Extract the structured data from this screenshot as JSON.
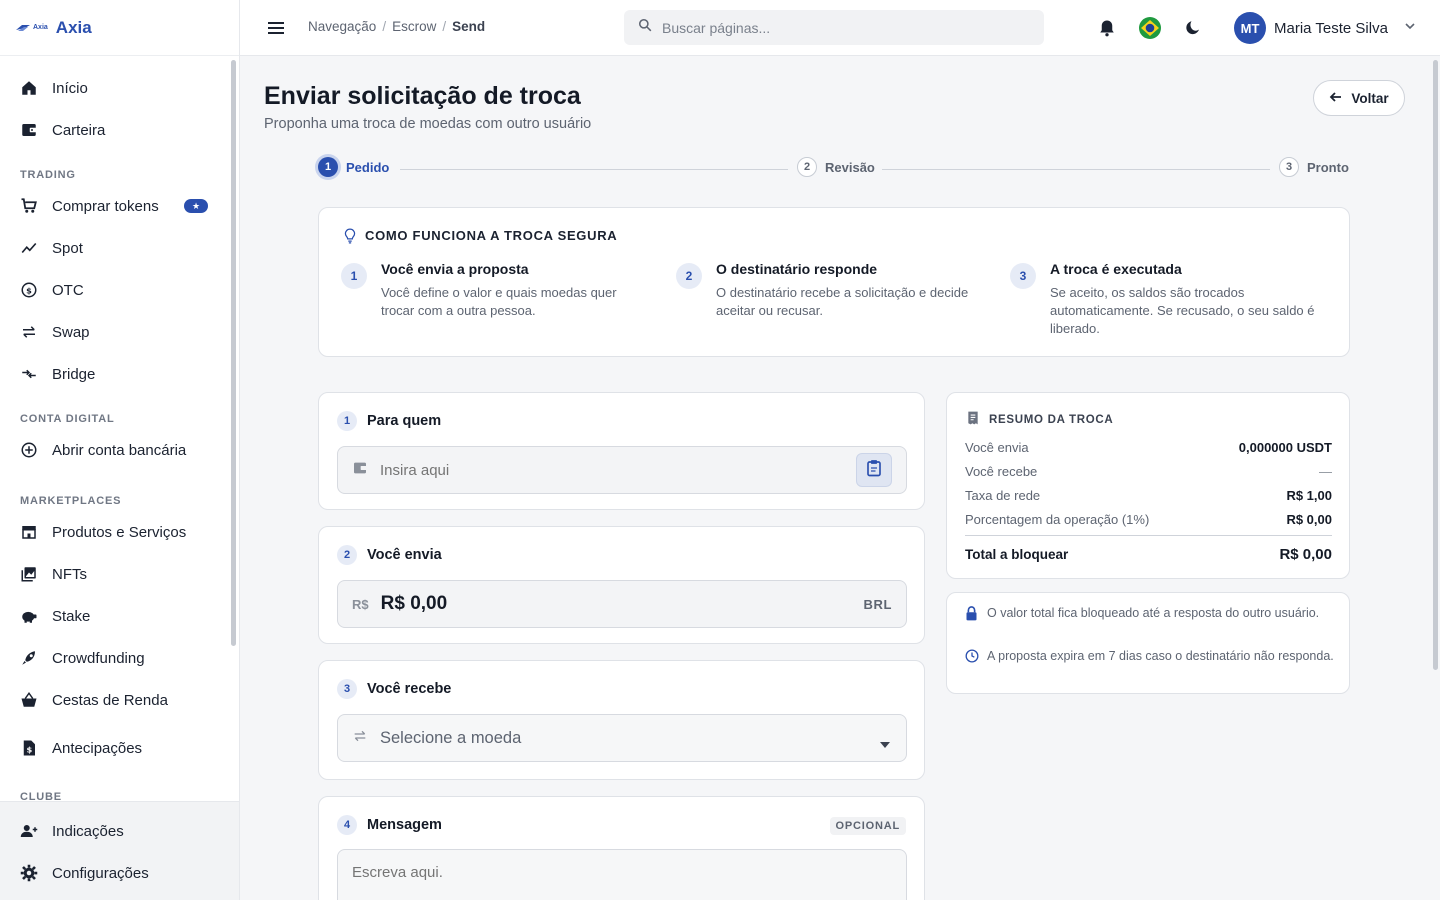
{
  "brand": {
    "mark_text": "Axia",
    "name": "Axia"
  },
  "sidebar": {
    "items_top": [
      {
        "label": "Início",
        "icon": "home-icon"
      },
      {
        "label": "Carteira",
        "icon": "wallet-icon"
      }
    ],
    "sections": [
      {
        "title": "TRADING",
        "items": [
          {
            "label": "Comprar tokens",
            "icon": "cart-icon",
            "badge": "★"
          },
          {
            "label": "Spot",
            "icon": "trend-icon"
          },
          {
            "label": "OTC",
            "icon": "otc-icon"
          },
          {
            "label": "Swap",
            "icon": "swap-icon"
          },
          {
            "label": "Bridge",
            "icon": "bridge-icon"
          }
        ]
      },
      {
        "title": "CONTA DIGITAL",
        "items": [
          {
            "label": "Abrir conta bancária",
            "icon": "plus-circle-icon"
          }
        ]
      },
      {
        "title": "MARKETPLACES",
        "items": [
          {
            "label": "Produtos e Serviços",
            "icon": "store-icon"
          },
          {
            "label": "NFTs",
            "icon": "image-icon"
          },
          {
            "label": "Stake",
            "icon": "piggy-icon"
          },
          {
            "label": "Crowdfunding",
            "icon": "rocket-icon"
          },
          {
            "label": "Cestas de Renda",
            "icon": "basket-icon"
          },
          {
            "label": "Antecipações",
            "icon": "document-dollar-icon"
          }
        ]
      },
      {
        "title": "CLUBE",
        "items": []
      }
    ],
    "bottom": [
      {
        "label": "Indicações",
        "icon": "user-add-icon"
      },
      {
        "label": "Configurações",
        "icon": "gear-icon"
      }
    ]
  },
  "topbar": {
    "breadcrumb": [
      "Navegação",
      "Escrow",
      "Send"
    ],
    "search_placeholder": "Buscar páginas...",
    "user_initials": "MT",
    "user_name": "Maria Teste Silva"
  },
  "page": {
    "title": "Enviar solicitação de troca",
    "subtitle": "Proponha uma troca de moedas com outro usuário",
    "back_label": "Voltar"
  },
  "stepper": [
    {
      "num": "1",
      "label": "Pedido",
      "state": "active"
    },
    {
      "num": "2",
      "label": "Revisão",
      "state": "idle"
    },
    {
      "num": "3",
      "label": "Pronto",
      "state": "idle"
    }
  ],
  "how": {
    "title": "COMO FUNCIONA A TROCA SEGURA",
    "items": [
      {
        "num": "1",
        "title": "Você envia a proposta",
        "desc": "Você define o valor e quais moedas quer trocar com a outra pessoa."
      },
      {
        "num": "2",
        "title": "O destinatário responde",
        "desc": "O destinatário recebe a solicitação e decide aceitar ou recusar."
      },
      {
        "num": "3",
        "title": "A troca é executada",
        "desc": "Se aceito, os saldos são trocados automaticamente. Se recusado, o seu saldo é liberado."
      }
    ]
  },
  "form": {
    "to": {
      "num": "1",
      "label": "Para quem",
      "placeholder": "Insira aqui"
    },
    "send": {
      "num": "2",
      "label": "Você envia",
      "prefix": "R$",
      "value": "R$ 0,00",
      "currency": "BRL"
    },
    "receive": {
      "num": "3",
      "label": "Você recebe",
      "placeholder": "Selecione a moeda"
    },
    "message": {
      "num": "4",
      "label": "Mensagem",
      "optional": "OPCIONAL",
      "placeholder": "Escreva aqui."
    }
  },
  "summary": {
    "title": "RESUMO DA TROCA",
    "rows": [
      {
        "label": "Você envia",
        "value": "0,000000 USDT"
      },
      {
        "label": "Você recebe",
        "value": "—"
      },
      {
        "label": "Taxa de rede",
        "value": "R$ 1,00"
      },
      {
        "label": "Porcentagem da operação (1%)",
        "value": "R$ 0,00"
      }
    ],
    "total_label": "Total a bloquear",
    "total_value": "R$ 0,00"
  },
  "notes": [
    {
      "icon": "lock-icon",
      "text": "O valor total fica bloqueado até a resposta do outro usuário."
    },
    {
      "icon": "clock-icon",
      "text": "A proposta expira em 7 dias caso o destinatário não responda."
    }
  ],
  "colors": {
    "accent": "#2a4fae",
    "background": "#f5f6f8"
  }
}
